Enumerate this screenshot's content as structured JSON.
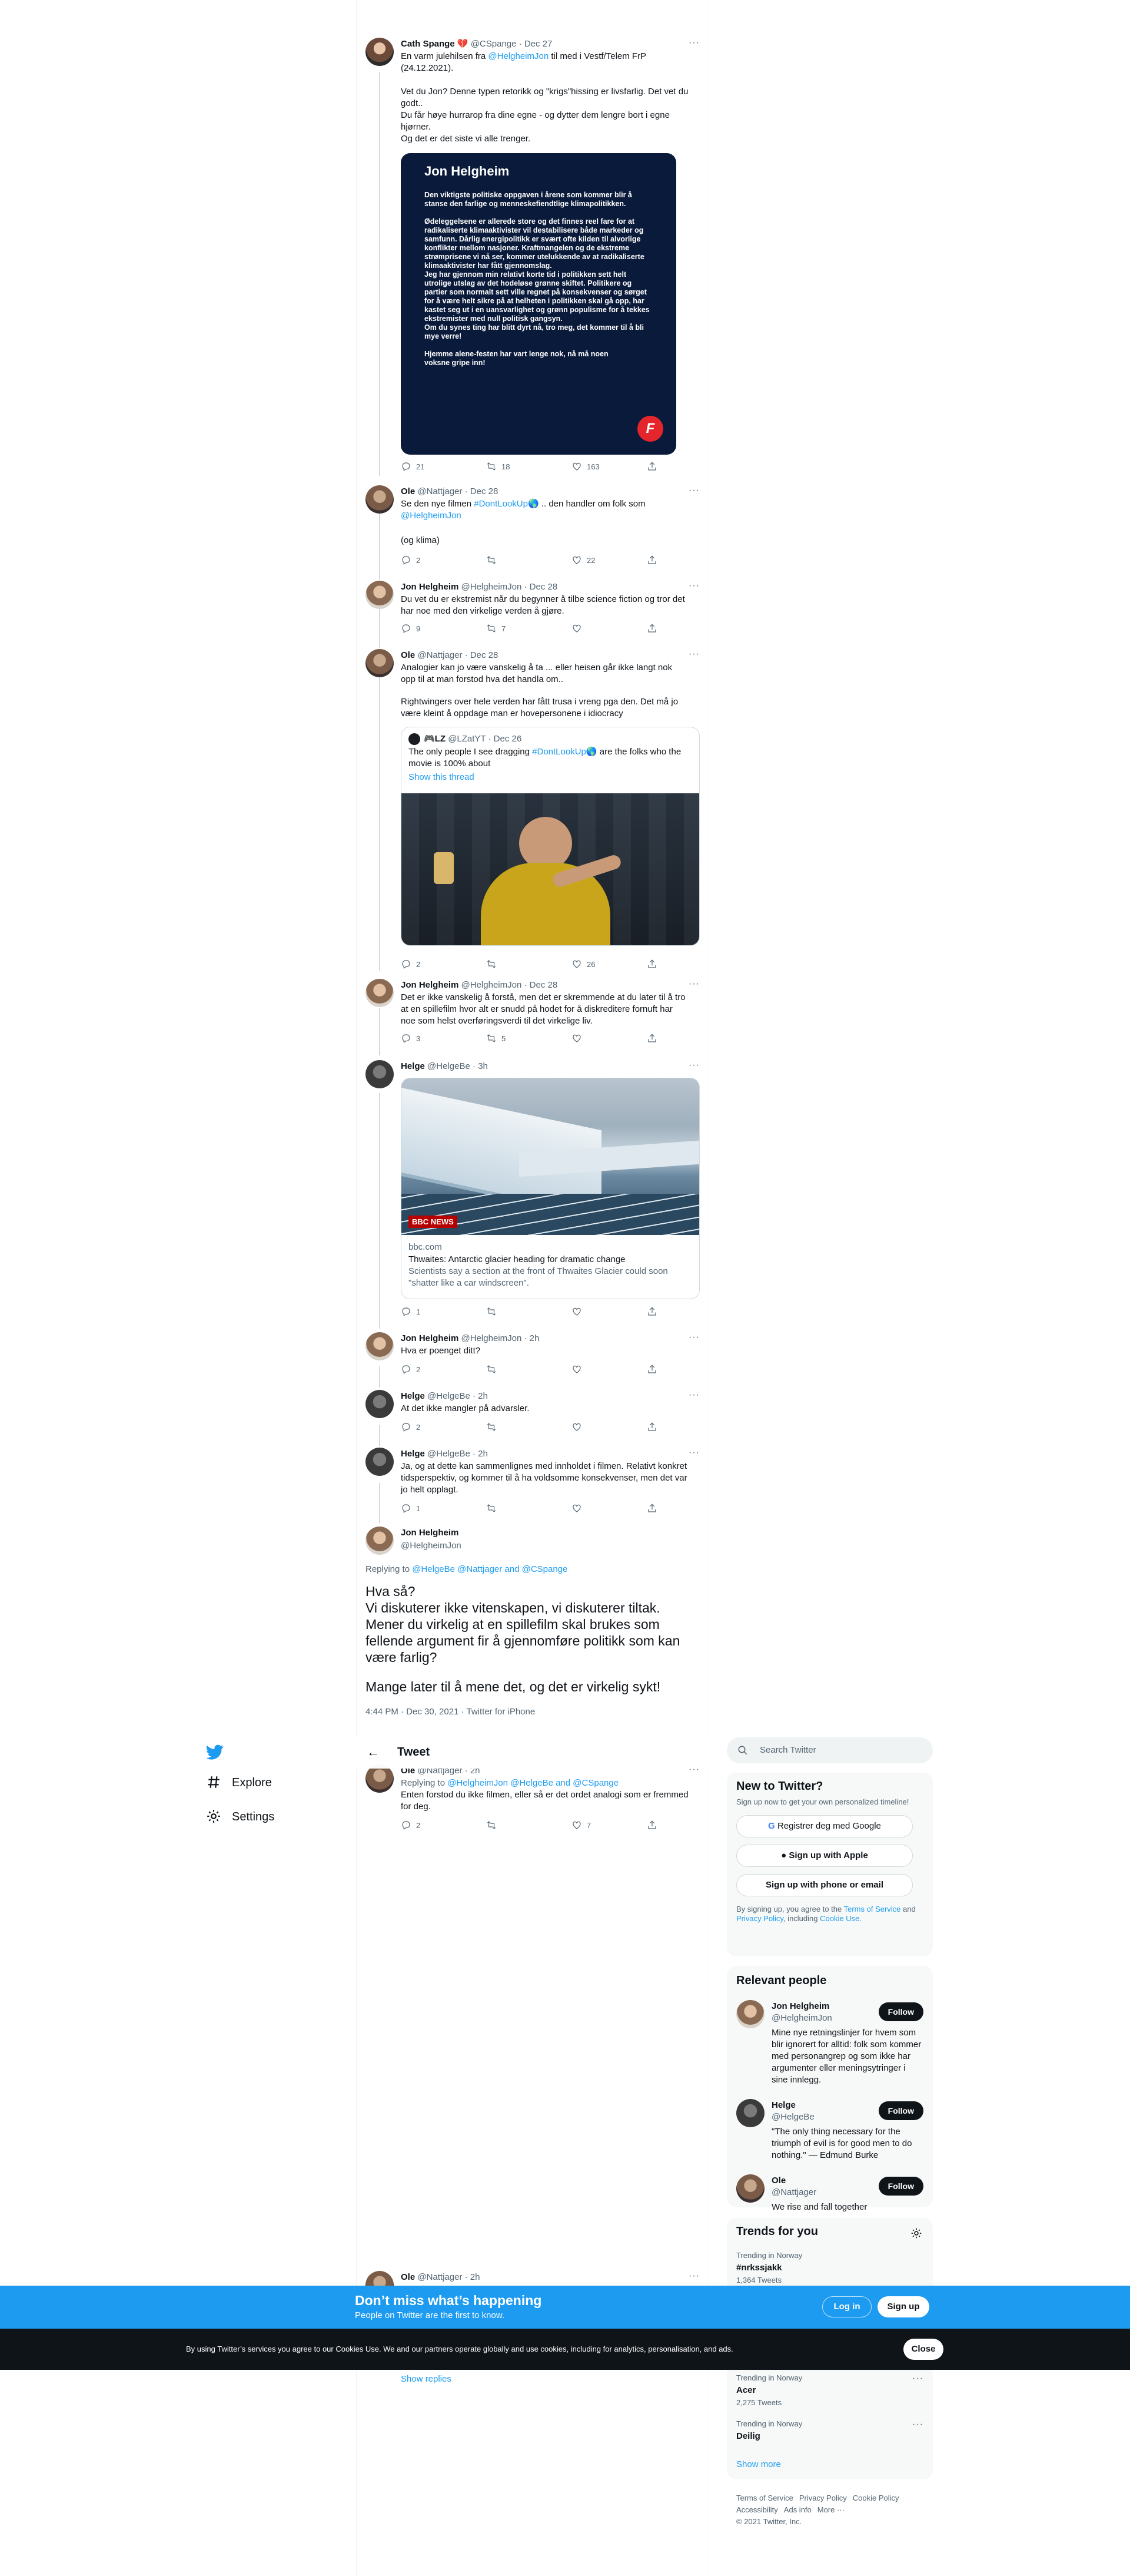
{
  "tweets": {
    "cath": {
      "name": "Cath Spange 💔",
      "handle": "@CSpange",
      "date": "Dec 27",
      "text_pre": "En varm julehilsen fra ",
      "mention": "@HelgheimJon",
      "text_post": " til med i Vestf/Telem FrP (24.12.2021).",
      "lines": [
        "Vet du Jon? Denne typen retorikk og \"krigs\"hissing er livsfarlig. Det vet du godt..",
        "Du får høye hurrarop fra dine egne - og dytter dem lengre bort i egne hjørner.",
        "Og det er det siste vi alle trenger."
      ],
      "image": {
        "title": "Jon Helgheim",
        "body": [
          "Den viktigste politiske oppgaven i årene som kommer blir å stanse den farlige og menneskefiendtlige klimapolitikken.",
          "Ødeleggelsene er allerede store og det finnes reel fare for at radikaliserte klimaaktivister vil destabilisere både markeder og samfunn. Dårlig energipolitikk er svært ofte kilden til alvorlige konflikter mellom nasjoner. Kraftmangelen og de ekstreme strømprisene vi nå ser, kommer utelukkende av at radikaliserte klimaaktivister har fått gjennomslag.",
          "Jeg har gjennom min relativt korte tid i politikken sett helt utrolige utslag av det hodeløse grønne skiftet. Politikere og partier som normalt sett ville regnet på konsekvenser og sørget for å være helt sikre på at helheten i politikken skal gå opp, har kastet seg ut i en uansvarlighet og grønn populisme for å tekkes ekstremister med null politisk gangsyn.",
          "Om du synes ting har blitt dyrt nå, tro meg, det kommer til å bli mye verre!",
          "Hjemme alene-festen har vart lenge nok, nå må noen voksne gripe inn!"
        ],
        "logo": "F"
      },
      "reply": "21",
      "retweet": "18",
      "like": "163"
    },
    "ole1": {
      "name": "Ole",
      "handle": "@Nattjager",
      "date": "Dec 28",
      "text_pre": "Se den nye filmen ",
      "hashtag": "#DontLookUp",
      "emoji": "🌎",
      "text_mid": " .. den handler om folk som ",
      "mention": "@HelgheimJon",
      "text2": "(og klima)",
      "reply": "2",
      "like": "22"
    },
    "jon1": {
      "name": "Jon Helgheim",
      "handle": "@HelgheimJon",
      "date": "Dec 28",
      "text": "Du vet du er ekstremist når du begynner å tilbe science fiction og tror det har noe med den virkelige verden å gjøre.",
      "reply": "9",
      "retweet": "7"
    },
    "ole2": {
      "name": "Ole",
      "handle": "@Nattjager",
      "date": "Dec 28",
      "text": "Analogier kan jo være vanskelig å ta ... eller heisen går ikke langt nok opp til at man forstod hva det handla om..",
      "text2": "Rightwingers over hele verden har fått trusa i vreng pga den. Det må jo være kleint å oppdage man er hovepersonene i idiocracy",
      "quote": {
        "name": "🎮LZ",
        "handle": "@LZatYT",
        "date": "Dec 26",
        "text_pre": "The only people I see dragging ",
        "hashtag": "#DontLookUp",
        "emoji": "🌎",
        "text_post": " are the folks who the movie is 100% about",
        "show": "Show this thread"
      },
      "reply": "2",
      "like": "26"
    },
    "jon2": {
      "name": "Jon Helgheim",
      "handle": "@HelgheimJon",
      "date": "Dec 28",
      "text": "Det er ikke vanskelig å forstå, men det er skremmende at du later til å tro at en spillefilm hvor alt er snudd på hodet for å diskreditere fornuft har noe som helst overføringsverdi til det virkelige liv.",
      "reply": "3",
      "retweet": "5"
    },
    "helge1": {
      "name": "Helge",
      "handle": "@HelgeBe",
      "date": "3h",
      "card": {
        "badge": "BBC NEWS",
        "domain": "bbc.com",
        "title": "Thwaites: Antarctic glacier heading for dramatic change",
        "desc": "Scientists say a section at the front of Thwaites Glacier could soon \"shatter like a car windscreen\"."
      },
      "reply": "1"
    },
    "jon3": {
      "name": "Jon Helgheim",
      "handle": "@HelgheimJon",
      "date": "2h",
      "text": "Hva er poenget ditt?",
      "reply": "2"
    },
    "helge2": {
      "name": "Helge",
      "handle": "@HelgeBe",
      "date": "2h",
      "text": "At det ikke mangler på advarsler.",
      "reply": "2"
    },
    "helge3": {
      "name": "Helge",
      "handle": "@HelgeBe",
      "date": "2h",
      "text": "Ja, og at dette kan sammenlignes med innholdet i filmen. Relativt konkret tidsperspektiv, og kommer til å ha voldsomme konsekvenser, men det var jo helt opplagt.",
      "reply": "1"
    },
    "main": {
      "name": "Jon Helgheim",
      "handle": "@HelgheimJon",
      "replying": "Replying to ",
      "replying_to": "@HelgeBe @Nattjager and @CSpange",
      "lines": [
        "Hva så?",
        "Vi diskuterer ikke vitenskapen, vi diskuterer tiltak.",
        "Mener du virkelig at en spillefilm skal brukes som fellende argument fir å gjennomføre politikk som kan være farlig?"
      ],
      "line2": "Mange later til å mene det, og det er virkelig sykt!",
      "meta": "4:44 PM · Dec 30, 2021 · Twitter for iPhone"
    },
    "ole3": {
      "name": "Ole",
      "handle": "@Nattjager",
      "date": "2h",
      "replying": "Replying to ",
      "replying_to": "@HelgheimJon @HelgeBe and @CSpange",
      "text": "Enten forstod du ikke filmen, eller så er det ordet analogi som er fremmed for deg.",
      "reply": "2",
      "like": "7"
    },
    "ole4": {
      "name": "Ole",
      "handle": "@Nattjager",
      "date": "2h",
      "show_replies": "Show replies"
    }
  },
  "topbar": {
    "back": "←",
    "title": "Tweet"
  },
  "nav": {
    "explore": "Explore",
    "settings": "Settings"
  },
  "search": {
    "placeholder": "Search Twitter"
  },
  "new_to_twitter": {
    "title": "New to Twitter?",
    "sub": "Sign up now to get your own personalized timeline!",
    "google": "Registrer deg med Google",
    "apple": "Sign up with Apple",
    "phone": "Sign up with phone or email",
    "legal_pre": "By signing up, you agree to the ",
    "terms": "Terms of Service",
    "and": " and ",
    "privacy": "Privacy Policy",
    "including": ", including ",
    "cookie": "Cookie Use."
  },
  "relevant": {
    "title": "Relevant people",
    "people": [
      {
        "name": "Jon Helgheim",
        "handle": "@HelgheimJon",
        "bio": "Mine nye retningslinjer for hvem som blir ignorert for alltid: folk som kommer med personangrep og som ikke har argumenter eller meningsytringer i sine innlegg.",
        "follow": "Follow"
      },
      {
        "name": "Helge",
        "handle": "@HelgeBe",
        "bio": "\"The only thing necessary for the triumph of evil is for good men to do nothing.\" — Edmund Burke",
        "follow": "Follow"
      },
      {
        "name": "Ole",
        "handle": "@Nattjager",
        "bio": "We rise and fall together",
        "follow": "Follow"
      }
    ]
  },
  "trends": {
    "title": "Trends for you",
    "items": [
      {
        "ctx": "Trending in Norway",
        "name": "#nrkssjakk",
        "count": "1,364 Tweets"
      },
      {
        "ctx": "Trending in Norway",
        "name": "Acer",
        "count": "2,275 Tweets"
      },
      {
        "ctx": "Trending in Norway",
        "name": "Deilig",
        "count": ""
      }
    ],
    "show_more": "Show more"
  },
  "footer": {
    "terms": "Terms of Service",
    "privacy": "Privacy Policy",
    "cookie": "Cookie Policy",
    "access": "Accessibility",
    "ads": "Ads info",
    "more": "More ···",
    "copy": "© 2021 Twitter, Inc."
  },
  "banner": {
    "title": "Don’t miss what’s happening",
    "sub": "People on Twitter are the first to know.",
    "login": "Log in",
    "signup": "Sign up"
  },
  "cookie_bar": {
    "text": "By using Twitter’s services you agree to our Cookies Use. We and our partners operate globally and use cookies, including for analytics, personalisation, and ads.",
    "close": "Close"
  }
}
